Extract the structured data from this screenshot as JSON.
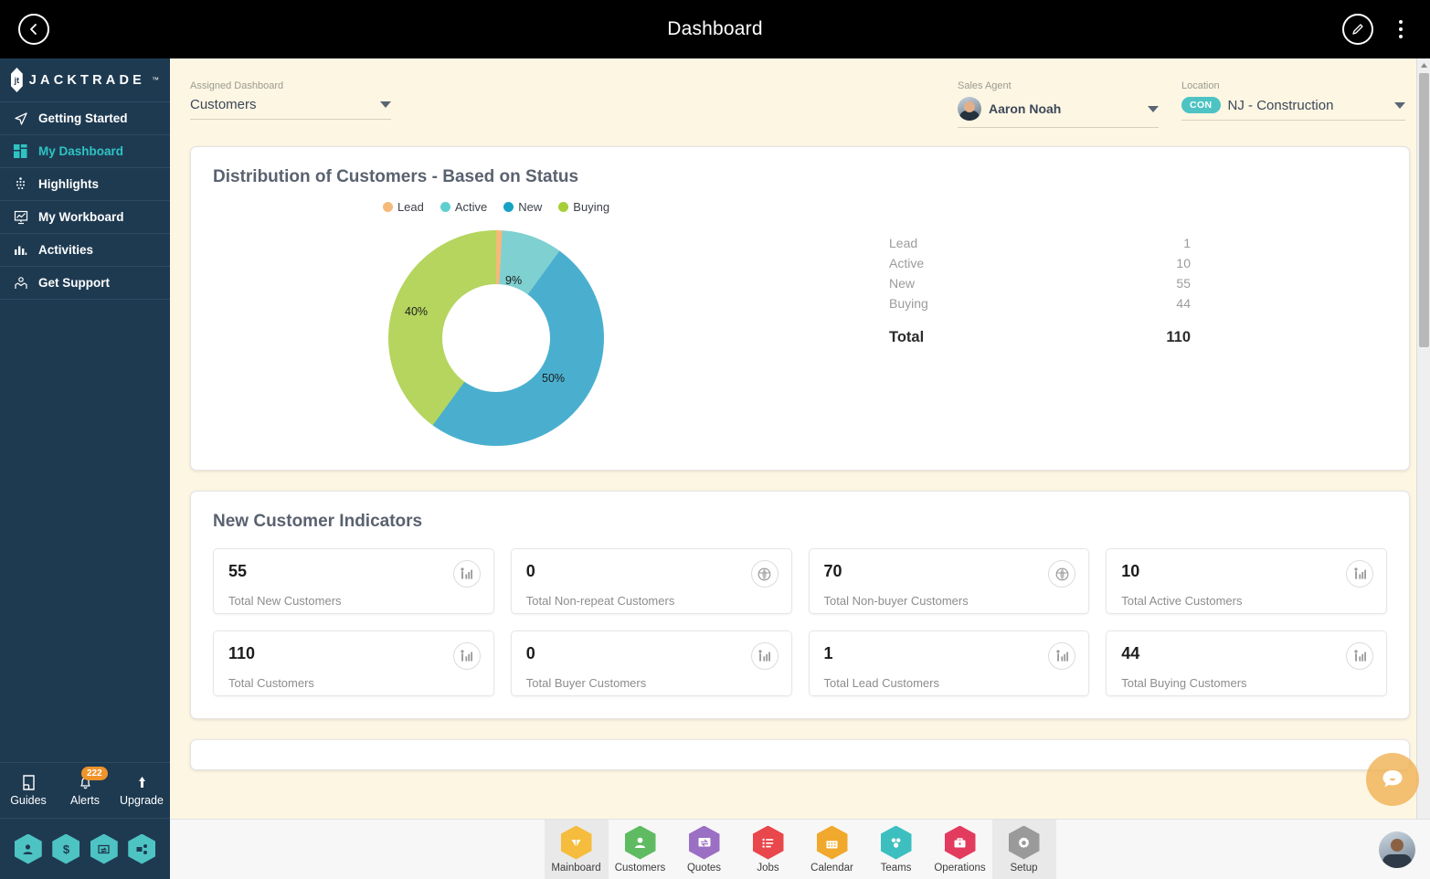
{
  "header": {
    "title": "Dashboard",
    "back_icon": "chevron-left-icon",
    "edit_icon": "pencil-icon",
    "menu_icon": "kebab-menu-icon"
  },
  "sidebar": {
    "brand": {
      "name": "JACKTRADE",
      "tm": "™",
      "mark": "jt"
    },
    "items": [
      {
        "label": "Getting Started",
        "icon": "navigation-arrow-icon",
        "active": false
      },
      {
        "label": "My Dashboard",
        "icon": "dashboard-grid-icon",
        "active": true
      },
      {
        "label": "Highlights",
        "icon": "highlights-dots-icon",
        "active": false
      },
      {
        "label": "My Workboard",
        "icon": "presentation-board-icon",
        "active": false
      },
      {
        "label": "Activities",
        "icon": "bar-chart-icon",
        "active": false
      },
      {
        "label": "Get Support",
        "icon": "support-hands-icon",
        "active": false
      }
    ],
    "tools": [
      {
        "label": "Guides",
        "icon": "book-icon",
        "badge": ""
      },
      {
        "label": "Alerts",
        "icon": "bell-icon",
        "badge": "222"
      },
      {
        "label": "Upgrade",
        "icon": "arrow-up-icon",
        "badge": ""
      }
    ],
    "quick_hexes": [
      {
        "icon": "person-icon"
      },
      {
        "icon": "dollar-icon"
      },
      {
        "icon": "quotes-icon"
      },
      {
        "icon": "workflow-icon"
      }
    ]
  },
  "filters": {
    "assigned_dashboard": {
      "label": "Assigned Dashboard",
      "value": "Customers"
    },
    "sales_agent": {
      "label": "Sales Agent",
      "value": "Aaron Noah",
      "avatar": "agent-avatar"
    },
    "location": {
      "label": "Location",
      "value": "NJ - Construction",
      "chip": "CON"
    }
  },
  "chart_card": {
    "title": "Distribution of Customers - Based on Status",
    "stats": [
      {
        "label": "Lead",
        "value": "1"
      },
      {
        "label": "Active",
        "value": "10"
      },
      {
        "label": "New",
        "value": "55"
      },
      {
        "label": "Buying",
        "value": "44"
      }
    ],
    "total": {
      "label": "Total",
      "value": "110"
    }
  },
  "chart_data": {
    "type": "pie",
    "title": "Distribution of Customers - Based on Status",
    "variant": "donut",
    "categories": [
      "Lead",
      "Active",
      "New",
      "Buying"
    ],
    "values": [
      1,
      10,
      55,
      44
    ],
    "percent_labels": [
      "",
      "9%",
      "50%",
      "40%"
    ],
    "colors": [
      "#f5b97a",
      "#7fd0d0",
      "#4aafcf",
      "#b5d55f"
    ],
    "total": 110,
    "legend_position": "top",
    "grid": false,
    "xlabel": "",
    "ylabel": ""
  },
  "indicators_card": {
    "title": "New Customer Indicators",
    "cards": [
      {
        "value": "55",
        "label": "Total New Customers",
        "icon": "bar-chart-people-icon"
      },
      {
        "value": "0",
        "label": "Total Non-repeat Customers",
        "icon": "globe-icon"
      },
      {
        "value": "70",
        "label": "Total Non-buyer Customers",
        "icon": "globe-icon"
      },
      {
        "value": "10",
        "label": "Total Active Customers",
        "icon": "bar-chart-people-icon"
      },
      {
        "value": "110",
        "label": "Total Customers",
        "icon": "bar-chart-people-icon"
      },
      {
        "value": "0",
        "label": "Total Buyer Customers",
        "icon": "bar-chart-people-icon"
      },
      {
        "value": "1",
        "label": "Total Lead Customers",
        "icon": "bar-chart-people-icon"
      },
      {
        "value": "44",
        "label": "Total Buying Customers",
        "icon": "bar-chart-people-icon"
      }
    ]
  },
  "bottom_nav": {
    "items": [
      {
        "label": "Mainboard",
        "icon": "diamond-icon",
        "color": "#f5bc3d",
        "active": true
      },
      {
        "label": "Customers",
        "icon": "person-icon",
        "color": "#5fbb62",
        "active": false
      },
      {
        "label": "Quotes",
        "icon": "quotes-icon",
        "color": "#9b6fc4",
        "active": false
      },
      {
        "label": "Jobs",
        "icon": "list-icon",
        "color": "#e8474b",
        "active": false
      },
      {
        "label": "Calendar",
        "icon": "calendar-icon",
        "color": "#f0a92c",
        "active": false
      },
      {
        "label": "Teams",
        "icon": "teams-icon",
        "color": "#3dbfbf",
        "active": false
      },
      {
        "label": "Operations",
        "icon": "briefcase-icon",
        "color": "#e23b5e",
        "active": false
      },
      {
        "label": "Setup",
        "icon": "gear-icon",
        "color": "#9a9a9a",
        "active": true
      }
    ]
  },
  "chat_widget": {
    "icon": "chat-bubble-icon"
  },
  "user_avatar": {
    "icon": "user-avatar"
  },
  "colors": {
    "sidebar_bg": "#1e3a51",
    "accent_teal": "#2ec4c4",
    "page_bg": "#fdf6e3",
    "badge_orange": "#f0932b"
  }
}
